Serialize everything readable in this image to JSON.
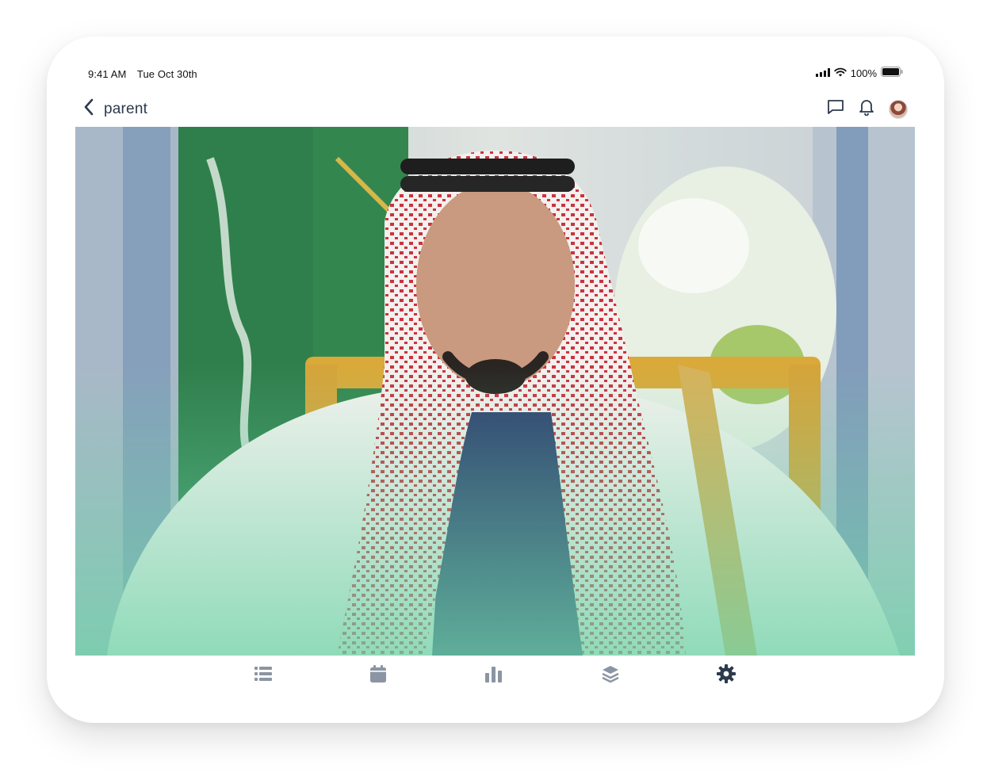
{
  "status_bar": {
    "time": "9:41 AM",
    "date": "Tue Oct 30th",
    "battery": "100%",
    "icons": [
      "signal-icon",
      "wifi-icon",
      "battery-icon"
    ]
  },
  "nav": {
    "back_label": "parent",
    "actions": [
      "chat-icon",
      "bell-icon",
      "avatar"
    ]
  },
  "hero": {
    "image_alt": "Photo: elderly man in red-and-white shemagh and white bisht seated in a gold chair before green flags",
    "overlay_color": "#6fd3a8"
  },
  "tab_bar": {
    "tabs": [
      {
        "icon": "list-icon",
        "active": false
      },
      {
        "icon": "calendar-icon",
        "active": false
      },
      {
        "icon": "bar-chart-icon",
        "active": false
      },
      {
        "icon": "layers-icon",
        "active": false
      },
      {
        "icon": "gear-icon",
        "active": true
      }
    ],
    "inactive_color": "#8b95a3",
    "active_color": "#2c3a4d"
  }
}
